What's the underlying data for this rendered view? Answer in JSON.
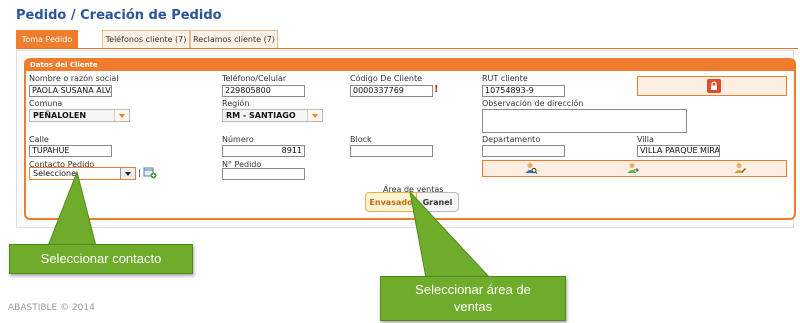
{
  "page": {
    "title": "Pedido / Creación de Pedido"
  },
  "tabs": [
    {
      "label": "Toma Pedido",
      "active": true
    },
    {
      "label": "Teléfonos cliente (7)",
      "active": false
    },
    {
      "label": "Reclamos cliente (7)",
      "active": false
    }
  ],
  "client": {
    "header": "Datos del Cliente",
    "name": {
      "label": "Nombre o razón social",
      "value": "PAOLA SUSANA ALVAR"
    },
    "phone": {
      "label": "Teléfono/Celular",
      "value": "229805800"
    },
    "code": {
      "label": "Código De Cliente",
      "value": "0000337769",
      "warning": "!"
    },
    "rut": {
      "label": "RUT cliente",
      "value": "10754893-9"
    },
    "comuna": {
      "label": "Comuna",
      "value": "PEÑALOLEN"
    },
    "region": {
      "label": "Región",
      "value": "RM - SANTIAGO"
    },
    "address_note": {
      "label": "Observación de dirección",
      "value": ""
    },
    "street": {
      "label": "Calle",
      "value": "TUPAHUE"
    },
    "number": {
      "label": "Número",
      "value": "8911"
    },
    "block": {
      "label": "Block",
      "value": ""
    },
    "department": {
      "label": "Departamento",
      "value": ""
    },
    "villa": {
      "label": "Villa",
      "value": "VILLA PARQUE MIRADO"
    },
    "contact": {
      "label": "Contacto Pedido",
      "value": "Seleccione"
    },
    "order_number": {
      "label": "N° Pedido",
      "value": ""
    }
  },
  "sales_area": {
    "label": "Área de ventas",
    "options": [
      "Envasado",
      "Granel"
    ],
    "selected": "Envasado"
  },
  "callouts": {
    "contact": "Seleccionar contacto",
    "sales_area_line1": "Seleccionar área de",
    "sales_area_line2": "ventas"
  },
  "footer": "ABASTIBLE © 2014",
  "colors": {
    "accent": "#ef7d2d",
    "title": "#2a5598",
    "callout": "#6fac2c"
  },
  "icons": [
    "lock-icon",
    "search-person-icon",
    "transfer-person-icon",
    "edit-person-icon",
    "add-contact-icon"
  ]
}
